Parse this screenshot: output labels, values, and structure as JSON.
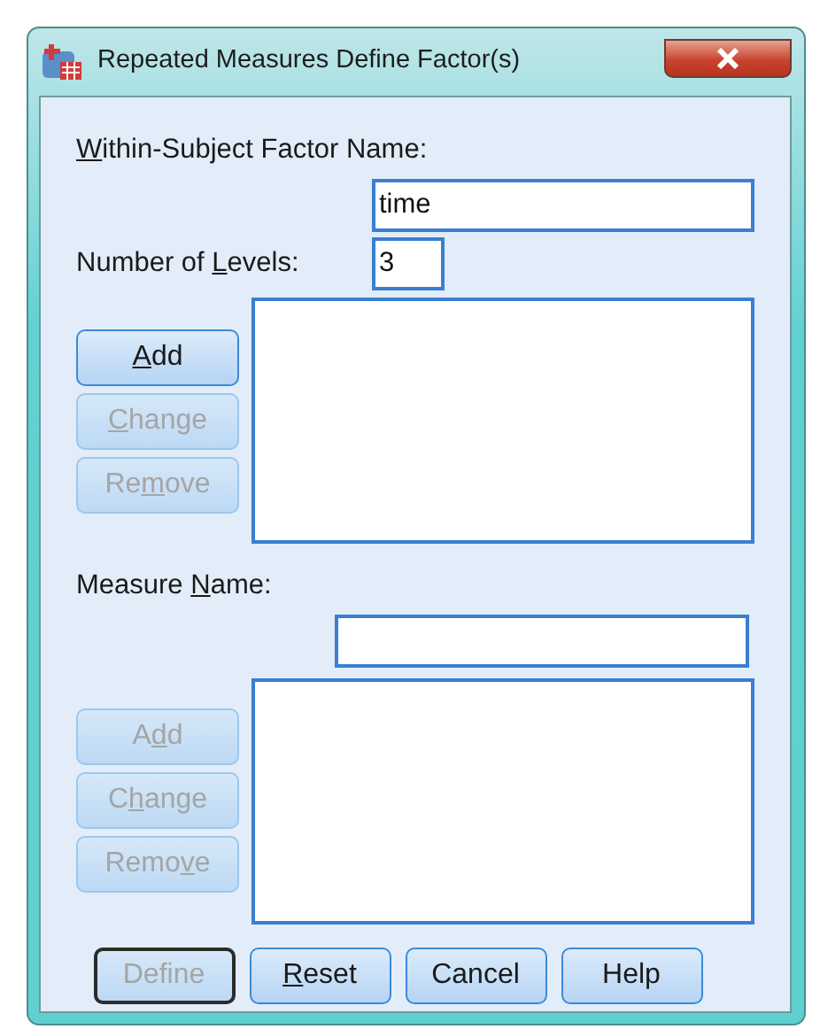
{
  "window": {
    "title": "Repeated Measures Define Factor(s)"
  },
  "factor_name": {
    "label": {
      "key": "W",
      "after": "ithin-Subject Factor Name:"
    },
    "value": "time"
  },
  "levels": {
    "label": {
      "before": "Number of ",
      "key": "L",
      "after": "evels:"
    },
    "value": "3"
  },
  "factor_buttons": [
    {
      "label": {
        "key": "A",
        "after": "dd"
      },
      "disabled": false
    },
    {
      "label": {
        "key": "C",
        "after": "hange"
      },
      "disabled": true
    },
    {
      "label": {
        "before": "Re",
        "key": "m",
        "after": "ove"
      },
      "disabled": true
    }
  ],
  "measure_name": {
    "label": {
      "before": "Measure ",
      "key": "N",
      "after": "ame:"
    }
  },
  "measure_buttons": [
    {
      "label": {
        "before": "A",
        "key": "d",
        "after": "d"
      },
      "disabled": true
    },
    {
      "label": {
        "before": "C",
        "key": "h",
        "after": "ange"
      },
      "disabled": true
    },
    {
      "label": {
        "before": "Remo",
        "key": "v",
        "after": "e"
      },
      "disabled": true
    }
  ],
  "footer_buttons": [
    {
      "label": {
        "after": "Define"
      },
      "disabled": true,
      "default": true
    },
    {
      "label": {
        "key": "R",
        "after": "eset"
      },
      "disabled": false,
      "default": false
    },
    {
      "label": {
        "after": "Cancel"
      },
      "disabled": false,
      "default": false
    },
    {
      "label": {
        "after": "Help"
      },
      "disabled": false,
      "default": false
    }
  ]
}
